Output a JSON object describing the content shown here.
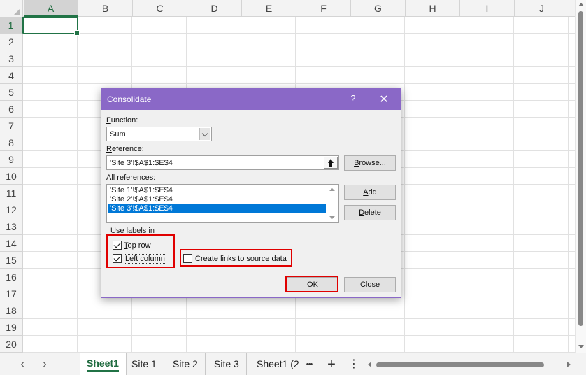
{
  "spreadsheet": {
    "columns": [
      "A",
      "B",
      "C",
      "D",
      "E",
      "F",
      "G",
      "H",
      "I",
      "J"
    ],
    "rows": [
      "1",
      "2",
      "3",
      "4",
      "5",
      "6",
      "7",
      "8",
      "9",
      "10",
      "11",
      "12",
      "13",
      "14",
      "15",
      "16",
      "17",
      "18",
      "19",
      "20"
    ],
    "active_column": "A",
    "active_row": "1"
  },
  "sheet_tabs": {
    "tabs": [
      "Sheet1",
      "Site 1",
      "Site 2",
      "Site 3",
      "Sheet1 (2"
    ],
    "active": "Sheet1",
    "more_label": "•••",
    "add_label": "+",
    "options_label": "⋮",
    "prev_label": "‹",
    "next_label": "›"
  },
  "dialog": {
    "title": "Consolidate",
    "help_label": "?",
    "close_label": "✕",
    "function_label_accel": "F",
    "function_label_rest": "unction:",
    "function_value": "Sum",
    "reference_label_accel": "R",
    "reference_label_rest": "eference:",
    "reference_value": "'Site 3'!$A$1:$E$4",
    "browse_accel": "B",
    "browse_rest": "rowse...",
    "all_refs_label_pre": "All r",
    "all_refs_label_accel": "e",
    "all_refs_label_post": "ferences:",
    "all_references": [
      "'Site 1'!$A$1:$E$4",
      "'Site 2'!$A$1:$E$4",
      "'Site 3'!$A$1:$E$4"
    ],
    "selected_reference_index": 2,
    "add_accel": "A",
    "add_rest": "dd",
    "delete_accel": "D",
    "delete_rest": "elete",
    "use_labels_title": "Use labels in",
    "top_row_accel": "T",
    "top_row_rest": "op row",
    "top_row_checked": true,
    "left_column_accel": "L",
    "left_column_rest": "eft column",
    "left_column_checked": true,
    "create_links_pre": "Create links to ",
    "create_links_accel": "s",
    "create_links_post": "ource data",
    "create_links_checked": false,
    "ok_label": "OK",
    "close_button_label": "Close"
  },
  "colors": {
    "dialog_titlebar": "#8a68c7",
    "selection_green": "#217346",
    "list_selection": "#0078d7",
    "highlight_red": "#e00000"
  }
}
